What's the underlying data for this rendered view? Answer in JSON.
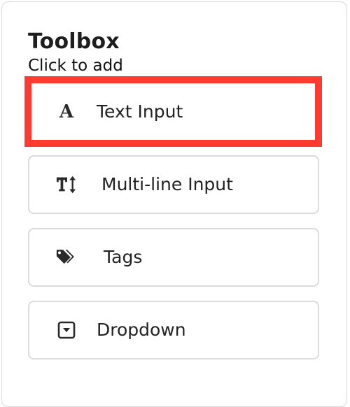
{
  "toolbox": {
    "title": "Toolbox",
    "subtitle": "Click to add"
  },
  "items": [
    {
      "label": "Text Input",
      "icon": "text-a-icon",
      "highlighted": true
    },
    {
      "label": "Multi-line Input",
      "icon": "text-height-icon",
      "highlighted": false
    },
    {
      "label": "Tags",
      "icon": "tags-icon",
      "highlighted": false
    },
    {
      "label": "Dropdown",
      "icon": "caret-square-down-icon",
      "highlighted": false
    }
  ],
  "colors": {
    "highlight": "#ff3b30",
    "border": "#dcdcdc",
    "text": "#222222"
  }
}
